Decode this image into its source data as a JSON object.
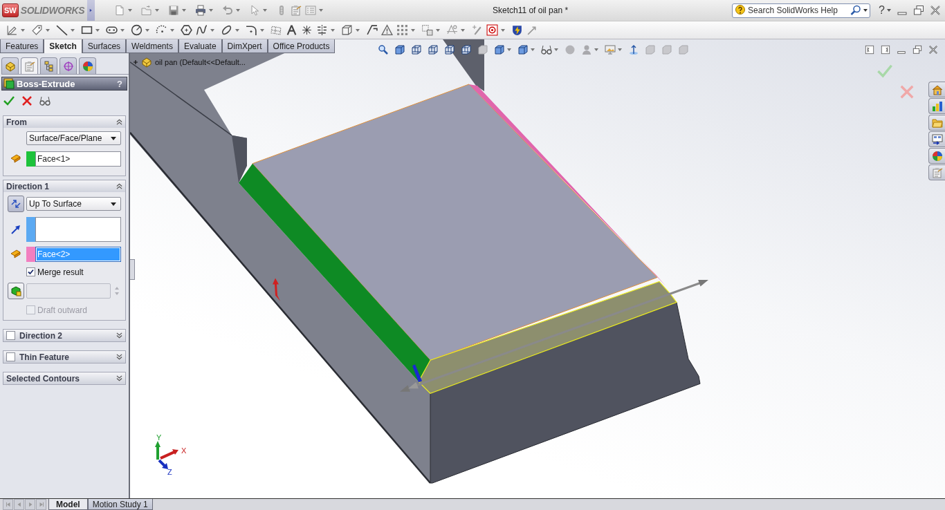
{
  "app": {
    "logo_mark": "SW",
    "logo": "SOLIDWORKS",
    "title": "Sketch11 of oil pan *",
    "search": {
      "placeholder": "Search SolidWorks Help"
    },
    "help": "?"
  },
  "command_tabs": [
    {
      "label": "Features",
      "selected": false
    },
    {
      "label": "Sketch",
      "selected": true
    },
    {
      "label": "Surfaces",
      "selected": false
    },
    {
      "label": "Weldments",
      "selected": false
    },
    {
      "label": "Evaluate",
      "selected": false
    },
    {
      "label": "DimXpert",
      "selected": false
    },
    {
      "label": "Office Products",
      "selected": false
    }
  ],
  "property_manager": {
    "panel_tabs": [
      {
        "kind": "feature_tree",
        "selected": false
      },
      {
        "kind": "properties",
        "selected": true
      },
      {
        "kind": "configurations",
        "selected": false
      },
      {
        "kind": "dimxpert",
        "selected": false
      },
      {
        "kind": "display",
        "selected": false
      }
    ],
    "title": "Boss-Extrude",
    "help": "?",
    "groups": [
      {
        "kind": "from",
        "title": "From",
        "expanded": true,
        "condition": "Surface/Face/Plane",
        "selections": [
          {
            "kind": "face",
            "value": "Face<1>",
            "color": "#1dc23b",
            "selected": false
          }
        ]
      },
      {
        "kind": "direction",
        "title": "Direction 1",
        "expanded": true,
        "condition": "Up To Surface",
        "selections": [
          {
            "kind": "direction",
            "color": "#5ba9f2",
            "selected": false
          },
          {
            "kind": "face",
            "value": "Face<2>",
            "color": "#f27fc0",
            "selected": true
          }
        ],
        "merge_result": {
          "label": "Merge result",
          "checked": true
        },
        "draft": {
          "disabled": true,
          "outward": {
            "label": "Draft outward",
            "checked": false
          }
        }
      },
      {
        "kind": "options",
        "title": "Direction 2",
        "expanded": false,
        "checked": false
      },
      {
        "kind": "options",
        "title": "Thin Feature",
        "expanded": false,
        "checked": false
      },
      {
        "kind": "options",
        "title": "Selected Contours",
        "expanded": false
      }
    ]
  },
  "viewport": {
    "tree_flyout": {
      "label": "oil pan  (Default<<Default...",
      "expanded": false
    },
    "triad": [
      {
        "kind": "x",
        "label": "X"
      },
      {
        "kind": "y",
        "label": "Y"
      },
      {
        "kind": "z",
        "label": "Z"
      }
    ]
  },
  "bottom_tabs": [
    {
      "label": "Model",
      "selected": true
    },
    {
      "label": "Motion Study 1",
      "selected": false
    }
  ]
}
